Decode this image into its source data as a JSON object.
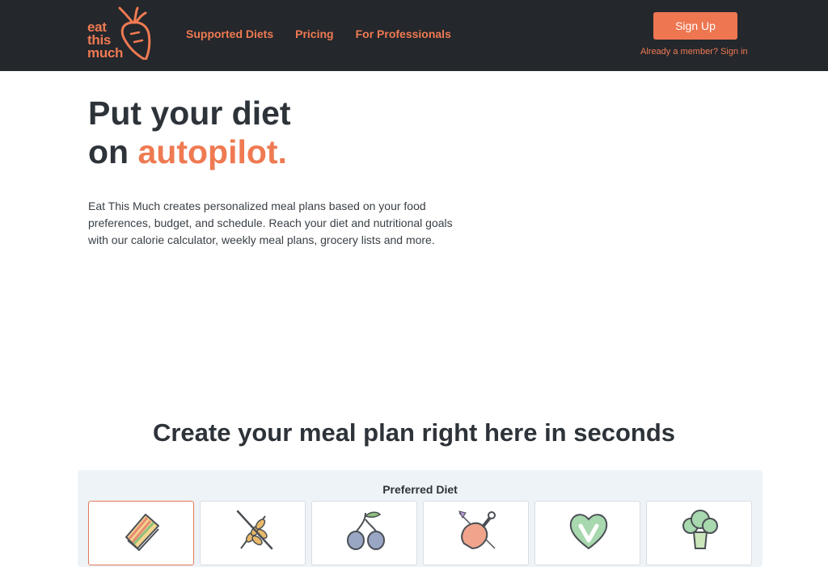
{
  "brand": {
    "logo_lines": [
      "eat",
      "this",
      "much"
    ]
  },
  "nav": {
    "items": [
      {
        "label": "Supported Diets"
      },
      {
        "label": "Pricing"
      },
      {
        "label": "For Professionals"
      }
    ],
    "signup_label": "Sign Up",
    "member_link": "Already a member? Sign in"
  },
  "hero": {
    "title_line1": "Put your diet",
    "title_line2_prefix": "on ",
    "title_accent": "autopilot.",
    "description": "Eat This Much creates personalized meal plans based on your food preferences, budget, and schedule. Reach your diet and nutritional goals with our calorie calculator, weekly meal plans, grocery lists and more."
  },
  "planner": {
    "title": "Create your meal plan right here in seconds",
    "preferred_diet_label": "Preferred Diet",
    "diets": [
      {
        "icon": "sandwich-icon",
        "selected": true
      },
      {
        "icon": "wheat-crossed-icon",
        "selected": false
      },
      {
        "icon": "olives-icon",
        "selected": false
      },
      {
        "icon": "ham-icon",
        "selected": false
      },
      {
        "icon": "vegan-heart-icon",
        "selected": false
      },
      {
        "icon": "broccoli-icon",
        "selected": false
      }
    ]
  },
  "colors": {
    "accent": "#ef7a52",
    "header_bg": "#24272c",
    "panel_bg": "#eef3f7",
    "text": "#2d3339"
  }
}
